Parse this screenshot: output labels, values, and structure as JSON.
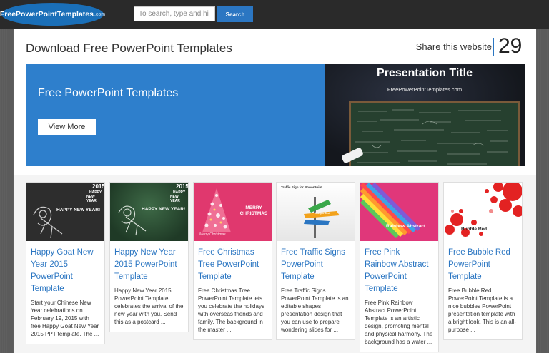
{
  "colors": {
    "accent": "#2b76c2",
    "topbar": "#2a2a2a",
    "hero_blue": "#2e7fcc"
  },
  "header": {
    "logo_text": "FreePowerPointTemplates",
    "logo_suffix": ".com",
    "search_placeholder": "To search, type and hi",
    "search_button": "Search"
  },
  "main": {
    "title": "Download Free PowerPoint Templates",
    "share_label": "Share this website",
    "share_count": "29"
  },
  "hero": {
    "title": "Free PowerPoint Templates",
    "button": "View More",
    "image_title": "Presentation Title",
    "image_subtitle": "FreePowerPointTemplates.com"
  },
  "cards": [
    {
      "title": "Happy Goat New Year 2015 PowerPoint Template",
      "desc": "Start your Chinese New Year celebrations on February 19, 2015 with free Happy Goat New Year 2015 PPT template. The ...",
      "thumb_year": "2015",
      "thumb_happy": "HAPPY",
      "thumb_ny": "NEW YEAR",
      "thumb_text": "HAPPY NEW YEAR!"
    },
    {
      "title": "Happy New Year 2015 PowerPoint Template",
      "desc": "Happy New Year 2015 PowerPoint Template celebrates the arrival of the new year with you. Send this as a postcard ...",
      "thumb_year": "2015",
      "thumb_happy": "HAPPY",
      "thumb_ny": "NEW YEAR",
      "thumb_text": "HAPPY NEW YEAR!"
    },
    {
      "title": "Free Christmas Tree PowerPoint Template",
      "desc": "Free Christmas Tree PowerPoint Template lets you celebrate the holidays with overseas friends and family. The background in the master ...",
      "thumb_text": "MERRY CHRISTMAS",
      "thumb_sub": "Merry Christmas"
    },
    {
      "title": "Free Traffic Signs PowerPoint Template",
      "desc": "Free Traffic Signs PowerPoint Template is an editable shapes presentation design that you can use to prepare wondering slides for ...",
      "thumb_text": "Traffic Sign for PowerPoint",
      "thumb_sign": "Sample Text"
    },
    {
      "title": "Free Pink Rainbow Abstract PowerPoint Template",
      "desc": "Free Pink Rainbow Abstract PowerPoint Template is an artistic design, promoting mental and physical harmony. The background has a water ...",
      "thumb_text": "Rainbow Abstract"
    },
    {
      "title": "Free Bubble Red PowerPoint Template",
      "desc": "Free Bubble Red PowerPoint Template is a nice bubbles PowerPoint presentation template with a bright look. This is an all-purpose ...",
      "thumb_text": "Bubble Red"
    }
  ]
}
